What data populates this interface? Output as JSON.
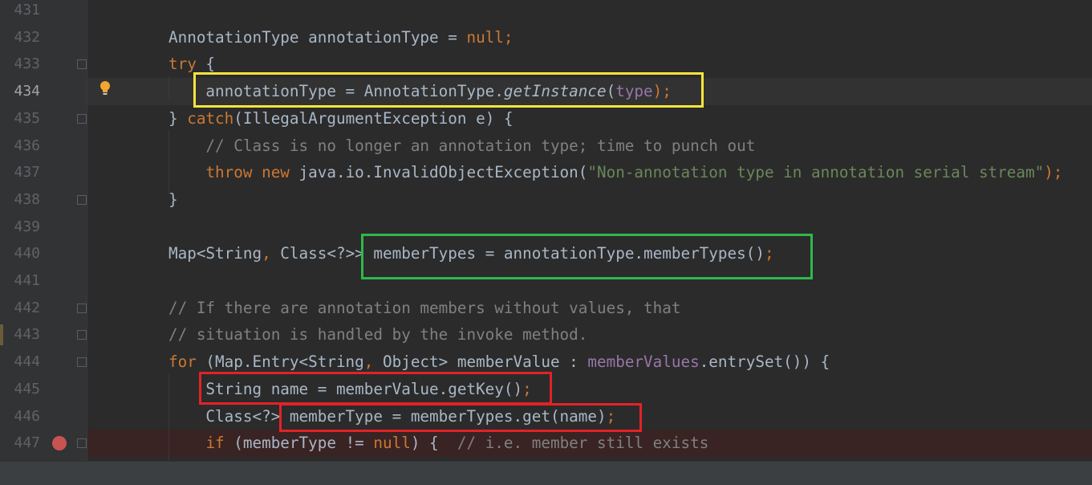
{
  "editor": {
    "lines": [
      {
        "no": "431",
        "parts": []
      },
      {
        "no": "432",
        "parts": [
          {
            "t": "AnnotationType annotationType = ",
            "c": ""
          },
          {
            "t": "null",
            "c": "kw"
          },
          {
            "t": ";",
            "c": "kw"
          }
        ]
      },
      {
        "no": "433",
        "parts": [
          {
            "t": "try",
            "c": "kw"
          },
          {
            "t": " {",
            "c": ""
          }
        ]
      },
      {
        "no": "434",
        "parts": [
          {
            "t": "    annotationType = AnnotationType.",
            "c": ""
          },
          {
            "t": "getInstance",
            "c": "static-m"
          },
          {
            "t": "(",
            "c": ""
          },
          {
            "t": "type",
            "c": "param"
          },
          {
            "t": ");",
            "c": "kw"
          }
        ]
      },
      {
        "no": "435",
        "parts": [
          {
            "t": "} ",
            "c": ""
          },
          {
            "t": "catch",
            "c": "kw"
          },
          {
            "t": "(IllegalArgumentException e) {",
            "c": ""
          }
        ]
      },
      {
        "no": "436",
        "parts": [
          {
            "t": "    // Class is no longer an annotation type; time to punch out",
            "c": "cmt"
          }
        ]
      },
      {
        "no": "437",
        "parts": [
          {
            "t": "    ",
            "c": ""
          },
          {
            "t": "throw new",
            "c": "kw"
          },
          {
            "t": " java.io.InvalidObjectException(",
            "c": ""
          },
          {
            "t": "\"Non-annotation type in annotation serial stream\"",
            "c": "str"
          },
          {
            "t": ");",
            "c": "kw"
          }
        ]
      },
      {
        "no": "438",
        "parts": [
          {
            "t": "}",
            "c": ""
          }
        ]
      },
      {
        "no": "439",
        "parts": []
      },
      {
        "no": "440",
        "parts": [
          {
            "t": "Map<String",
            "c": ""
          },
          {
            "t": ",",
            "c": "kw"
          },
          {
            "t": " Class<?>> memberTypes = annotationType.memberTypes()",
            "c": ""
          },
          {
            "t": ";",
            "c": "kw"
          }
        ]
      },
      {
        "no": "441",
        "parts": []
      },
      {
        "no": "442",
        "parts": [
          {
            "t": "// If there are annotation members without values, that",
            "c": "cmt"
          }
        ]
      },
      {
        "no": "443",
        "parts": [
          {
            "t": "// situation is handled by the invoke method.",
            "c": "cmt"
          }
        ]
      },
      {
        "no": "444",
        "parts": [
          {
            "t": "for",
            "c": "kw"
          },
          {
            "t": " (Map.Entry<String",
            "c": ""
          },
          {
            "t": ",",
            "c": "kw"
          },
          {
            "t": " Object> memberValue : ",
            "c": ""
          },
          {
            "t": "memberValues",
            "c": "field"
          },
          {
            "t": ".entrySet()) {",
            "c": ""
          }
        ]
      },
      {
        "no": "445",
        "parts": [
          {
            "t": "    String name = memberValue.getKey()",
            "c": ""
          },
          {
            "t": ";",
            "c": "kw"
          }
        ]
      },
      {
        "no": "446",
        "parts": [
          {
            "t": "    Class<?> memberType = memberTypes.get(name)",
            "c": ""
          },
          {
            "t": ";",
            "c": "kw"
          }
        ]
      },
      {
        "no": "447",
        "parts": [
          {
            "t": "    ",
            "c": ""
          },
          {
            "t": "if",
            "c": "kw"
          },
          {
            "t": " (memberType != ",
            "c": ""
          },
          {
            "t": "null",
            "c": "kw"
          },
          {
            "t": ") {  ",
            "c": ""
          },
          {
            "t": "// i.e. member still exists",
            "c": "cmt"
          }
        ]
      }
    ],
    "current_line": "434",
    "breakpoint_line": "447",
    "fold_markers": [
      "433",
      "435",
      "438",
      "442",
      "443",
      "444",
      "447"
    ],
    "intention_icon": "lightbulb-icon",
    "breakpoint_icon": "breakpoint-icon"
  },
  "colors": {
    "background": "#2b2b2b",
    "gutter": "#313335",
    "keyword": "#cc7832",
    "string": "#6a8759",
    "comment": "#808080",
    "field": "#9876aa",
    "highlight_yellow": "#f7e43c",
    "highlight_green": "#2eb84b",
    "highlight_red": "#e32227",
    "breakpoint": "#c75450"
  }
}
